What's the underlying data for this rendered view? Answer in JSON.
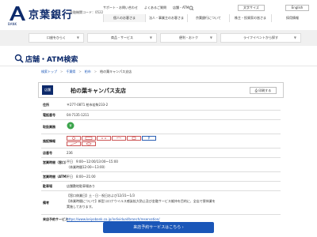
{
  "header": {
    "logo_text": "京葉銀行",
    "logo_sub": "BANK",
    "bank_code": "金融機関コード：0522",
    "util_links": [
      "サポート・お問い合わせ",
      "よくあるご質問",
      "店舗・ATM"
    ],
    "lang_jp": "文字サイズ",
    "lang_en": "English",
    "nav_tabs": [
      "個人のお客さま",
      "法人・事業主のお客さま",
      "京葉銀行について",
      "株主・投資家の皆さま",
      "採用情報"
    ]
  },
  "subnav": {
    "items": [
      "口座をひらく",
      "商品・サービス",
      "便利・おトク",
      "ライフイベントから探す"
    ]
  },
  "page": {
    "title": "店舗・ATM検索"
  },
  "breadcrumb": [
    "検索トップ",
    "千葉県",
    "柏市",
    "柏の葉キャンパス支店"
  ],
  "branch": {
    "tag": "店舗",
    "name": "柏の葉キャンパス支店",
    "print_label": "印刷する"
  },
  "info": {
    "address_label": "住所",
    "address_value": "〒277-0871 柏市若柴233-2",
    "phone_label": "電話番号",
    "phone_value": "04-7135-1211",
    "services_label": "取扱業務",
    "facilities_label": "施設情報",
    "store_no_label": "店番号",
    "store_no_value": "236",
    "hours_window_label": "営業時間（窓口）",
    "hours_window_value1": "平日　9:00～12:00/13:00～15:00",
    "hours_window_value2": "（休業時間12:00～13:00）",
    "hours_atm_label": "営業時間（ATM）",
    "hours_atm_value": "平日　8:00～21:00",
    "parking_label": "駐車場",
    "parking_value": "店舗敷地駐車場あり",
    "notes_label": "備考",
    "notes_value1": "【窓口休業日】土・日・祝日および12/31～1/3",
    "notes_value2": "【休業時間について】新型コロナウイルス感染拡大防止及び金融サービス維持を目的に、全店で昼休業を",
    "notes_value3": "実施しております。",
    "reserve_label": "来店予約サービス",
    "reserve_value": "https://www.keiyobank.co.jp/individual/branch/reservation/"
  },
  "cta": {
    "label": "来店予約サービスはこちら ›"
  }
}
